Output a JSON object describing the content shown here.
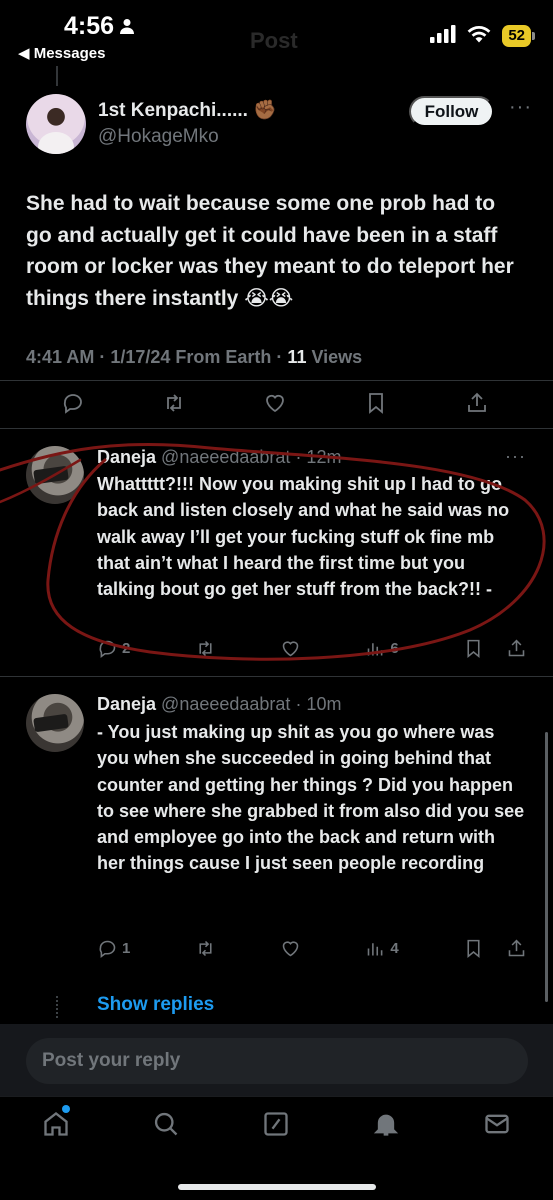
{
  "status_bar": {
    "time": "4:56",
    "back_label": "◀ Messages",
    "ghost_title": "Post",
    "battery": "52"
  },
  "tweet": {
    "author_name": "1st Kenpachi...... ✊🏾",
    "author_handle": "@HokageMko",
    "follow_label": "Follow",
    "text": "She had to wait because some one prob had to go and actually get it could have been in a staff room or locker was they meant to do teleport her things there instantly 😭😭",
    "timestamp": "4:41 AM · 1/17/24 From Earth · ",
    "views_count": "11",
    "views_label": " Views"
  },
  "replies": [
    {
      "name": "Daneja",
      "handle": "@naeeedaabrat",
      "time": "· 12m",
      "text": "Whattttt?!!! Now you making shit up I had to go back and listen closely and what he said was no walk away I’ll get your fucking stuff ok fine mb that ain’t what I heard the first time but you talking bout go get her stuff from the back?!! -",
      "reply_count": "2",
      "views_count": "6"
    },
    {
      "name": "Daneja",
      "handle": "@naeeedaabrat",
      "time": "· 10m",
      "text": "- You just making up shit as you go where was you when she succeeded in going behind that counter and getting her things ? Did you happen to see where she grabbed it from also did you see and employee go into the back and return with her things cause I just seen people recording",
      "reply_count": "1",
      "views_count": "4"
    }
  ],
  "show_replies_label": "Show replies",
  "composer": {
    "placeholder": "Post your reply"
  },
  "nav": [
    "home-icon",
    "search-icon",
    "compose-icon",
    "bell-icon",
    "mail-icon"
  ],
  "colors": {
    "background": "#000000",
    "link_blue": "#1d9bf0",
    "muted": "#71767b",
    "annotation_red": "#7a1614",
    "battery_yellow": "#e9c927"
  }
}
